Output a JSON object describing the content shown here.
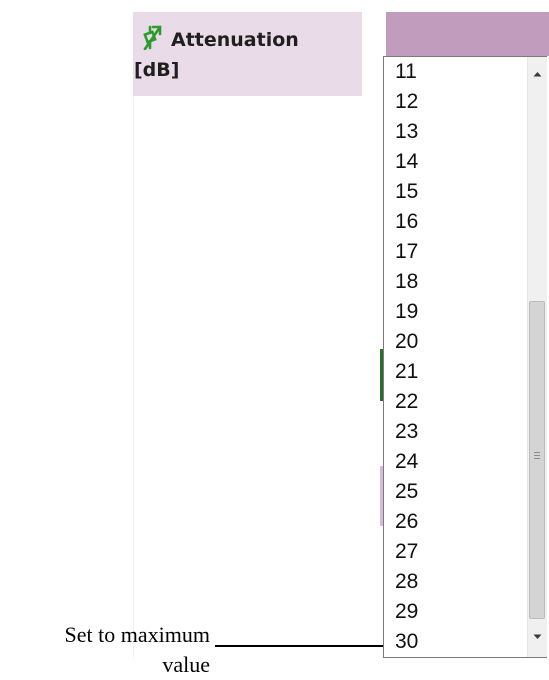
{
  "header": {
    "title": "Attenuation",
    "unit": "[dB]",
    "icon": "variable-attenuator-icon",
    "icon_color": "#2e9b2e",
    "background_color": "#eadbe8"
  },
  "dropdown": {
    "options": [
      "11",
      "12",
      "13",
      "14",
      "15",
      "16",
      "17",
      "18",
      "19",
      "20",
      "21",
      "22",
      "23",
      "24",
      "25",
      "26",
      "27",
      "28",
      "29",
      "30"
    ],
    "top_band_color": "#c19cbd",
    "scrollbar_icons": [
      "scroll-up-arrow-icon",
      "scroll-thumb-grip-icon",
      "scroll-down-arrow-icon"
    ]
  },
  "annotation": {
    "line1": "Set to maximum",
    "line2": "value"
  }
}
